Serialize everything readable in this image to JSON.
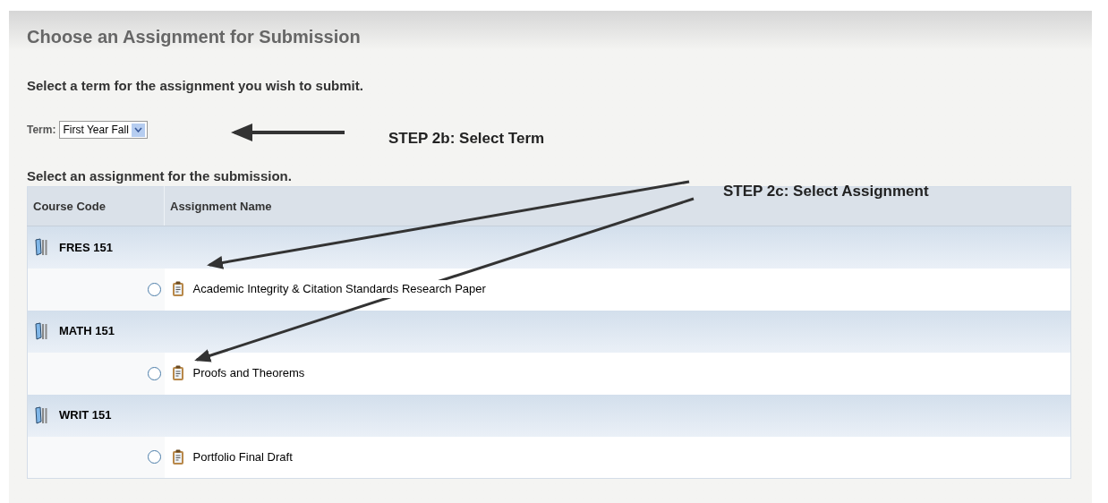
{
  "title": "Choose an Assignment for Submission",
  "term_prompt": "Select a term for the assignment you wish to submit.",
  "term": {
    "label": "Term:",
    "value": "First Year Fall"
  },
  "annotations": [
    {
      "text": "STEP 2b: Select Term"
    },
    {
      "text": "STEP 2c: Select Assignment"
    }
  ],
  "assignment_prompt": "Select an assignment for the submission.",
  "table": {
    "columns": [
      "Course Code",
      "Assignment Name"
    ],
    "courses": [
      {
        "code": "FRES 151",
        "assignments": [
          {
            "name": "Academic Integrity & Citation Standards Research Paper",
            "selected": false
          }
        ]
      },
      {
        "code": "MATH 151",
        "assignments": [
          {
            "name": "Proofs and Theorems",
            "selected": false
          }
        ]
      },
      {
        "code": "WRIT 151",
        "assignments": [
          {
            "name": "Portfolio Final Draft",
            "selected": false
          }
        ]
      }
    ]
  }
}
